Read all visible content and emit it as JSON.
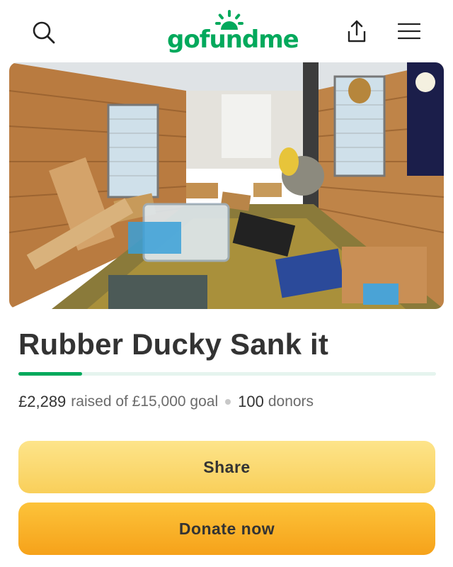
{
  "header": {
    "logo_text": "gofundme",
    "icons": [
      "search-icon",
      "share-icon",
      "menu-icon"
    ]
  },
  "hero": {
    "alt": "Flooded boat interior"
  },
  "campaign": {
    "title": "Rubber Ducky Sank it",
    "progress_fraction": 0.153,
    "raised": "£2,289",
    "raised_suffix": "raised of £15,000 goal",
    "donor_count": "100",
    "donor_label": "donors"
  },
  "actions": {
    "share_label": "Share",
    "donate_label": "Donate now"
  },
  "colors": {
    "brand_green": "#02a95c",
    "text": "#333333",
    "share_yellow": "#fbd86a",
    "donate_orange": "#f8b22c"
  }
}
